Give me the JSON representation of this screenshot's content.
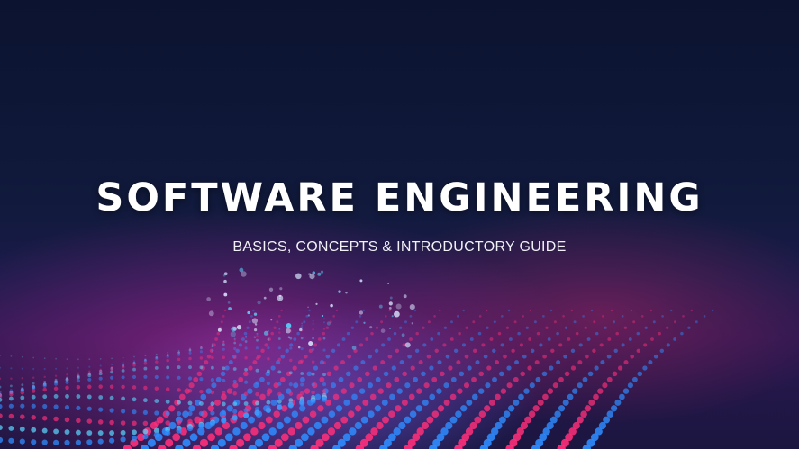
{
  "hero": {
    "title": "SOFTWARE ENGINEERING",
    "subtitle": "BASICS, CONCEPTS & INTRODUCTORY GUIDE"
  },
  "colors": {
    "background_top": "#0b1330",
    "particle_pink": "#ff2f7a",
    "particle_blue": "#2f8cff",
    "particle_cyan": "#59d8ff",
    "text": "#ffffff"
  }
}
